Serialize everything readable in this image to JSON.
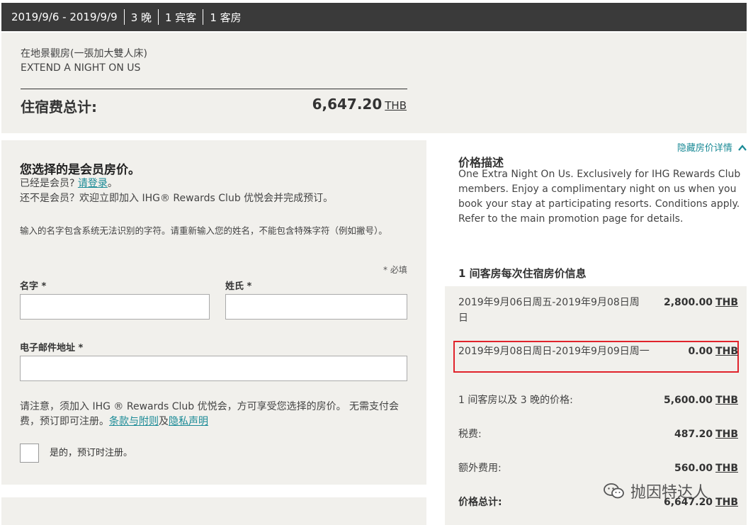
{
  "topbar": {
    "dates": "2019/9/6 - 2019/9/9",
    "nights": "3 晚",
    "guests": "1 宾客",
    "rooms": "1 客房"
  },
  "summary": {
    "room_name": "在地景觀房(一張加大雙人床)",
    "rate_name": "EXTEND A NIGHT ON US",
    "total_label": "住宿费总计:",
    "total_value": "6,647.20",
    "currency": "THB"
  },
  "member": {
    "title": "您选择的是会员房价。",
    "already_prefix": "已经是会员?",
    "login_link": "请登录",
    "already_suffix": "。",
    "join_text": "还不是会员？欢迎立即加入 IHG® Rewards Club 优悦会并完成预订。",
    "name_warning": "输入的名字包含系统无法识别的字符。请重新输入您的姓名，不能包含特殊字符（例如撇号）。",
    "required_note": "* 必填",
    "first_name_label": "名字 *",
    "last_name_label": "姓氏 *",
    "email_label": "电子邮件地址 *",
    "notice_text": "请注意，须加入 IHG ® Rewards Club 优悦会，方可享受您选择的房价。 无需支付会费，预订即可注册。",
    "terms_link": "条款与附则",
    "and_text": "及",
    "privacy_link": "隐私声明",
    "checkbox_label": "是的，预订时注册。"
  },
  "price": {
    "hide_details": "隐藏房价详情",
    "desc_title": "价格描述",
    "desc_text": "One Extra Night On Us. Exclusively for IHG Rewards Club members. Enjoy a complimentary night on us when you book your stay at participating resorts. Conditions apply. Refer to the main promotion page for details.",
    "per_stay_title": "1 间客房每次住宿房价信息",
    "rows": [
      {
        "label": "2019年9月06日周五-2019年9月08日周日",
        "value": "2,800.00",
        "currency": "THB"
      },
      {
        "label": "2019年9月08日周日-2019年9月09日周一",
        "value": "0.00",
        "currency": "THB"
      },
      {
        "label": "1 间客房以及 3 晚的价格:",
        "value": "5,600.00",
        "currency": "THB"
      },
      {
        "label": "税费:",
        "value": "487.20",
        "currency": "THB"
      },
      {
        "label": "额外费用:",
        "value": "560.00",
        "currency": "THB"
      },
      {
        "label": "价格总计:",
        "value": "6,647.20",
        "currency": "THB"
      }
    ]
  },
  "watermark": "抛因特达人",
  "colors": {
    "topbar_bg": "#3a3a3a",
    "panel_bg": "#f1f0ec",
    "link": "#1a8a96",
    "highlight": "#e0232b"
  }
}
